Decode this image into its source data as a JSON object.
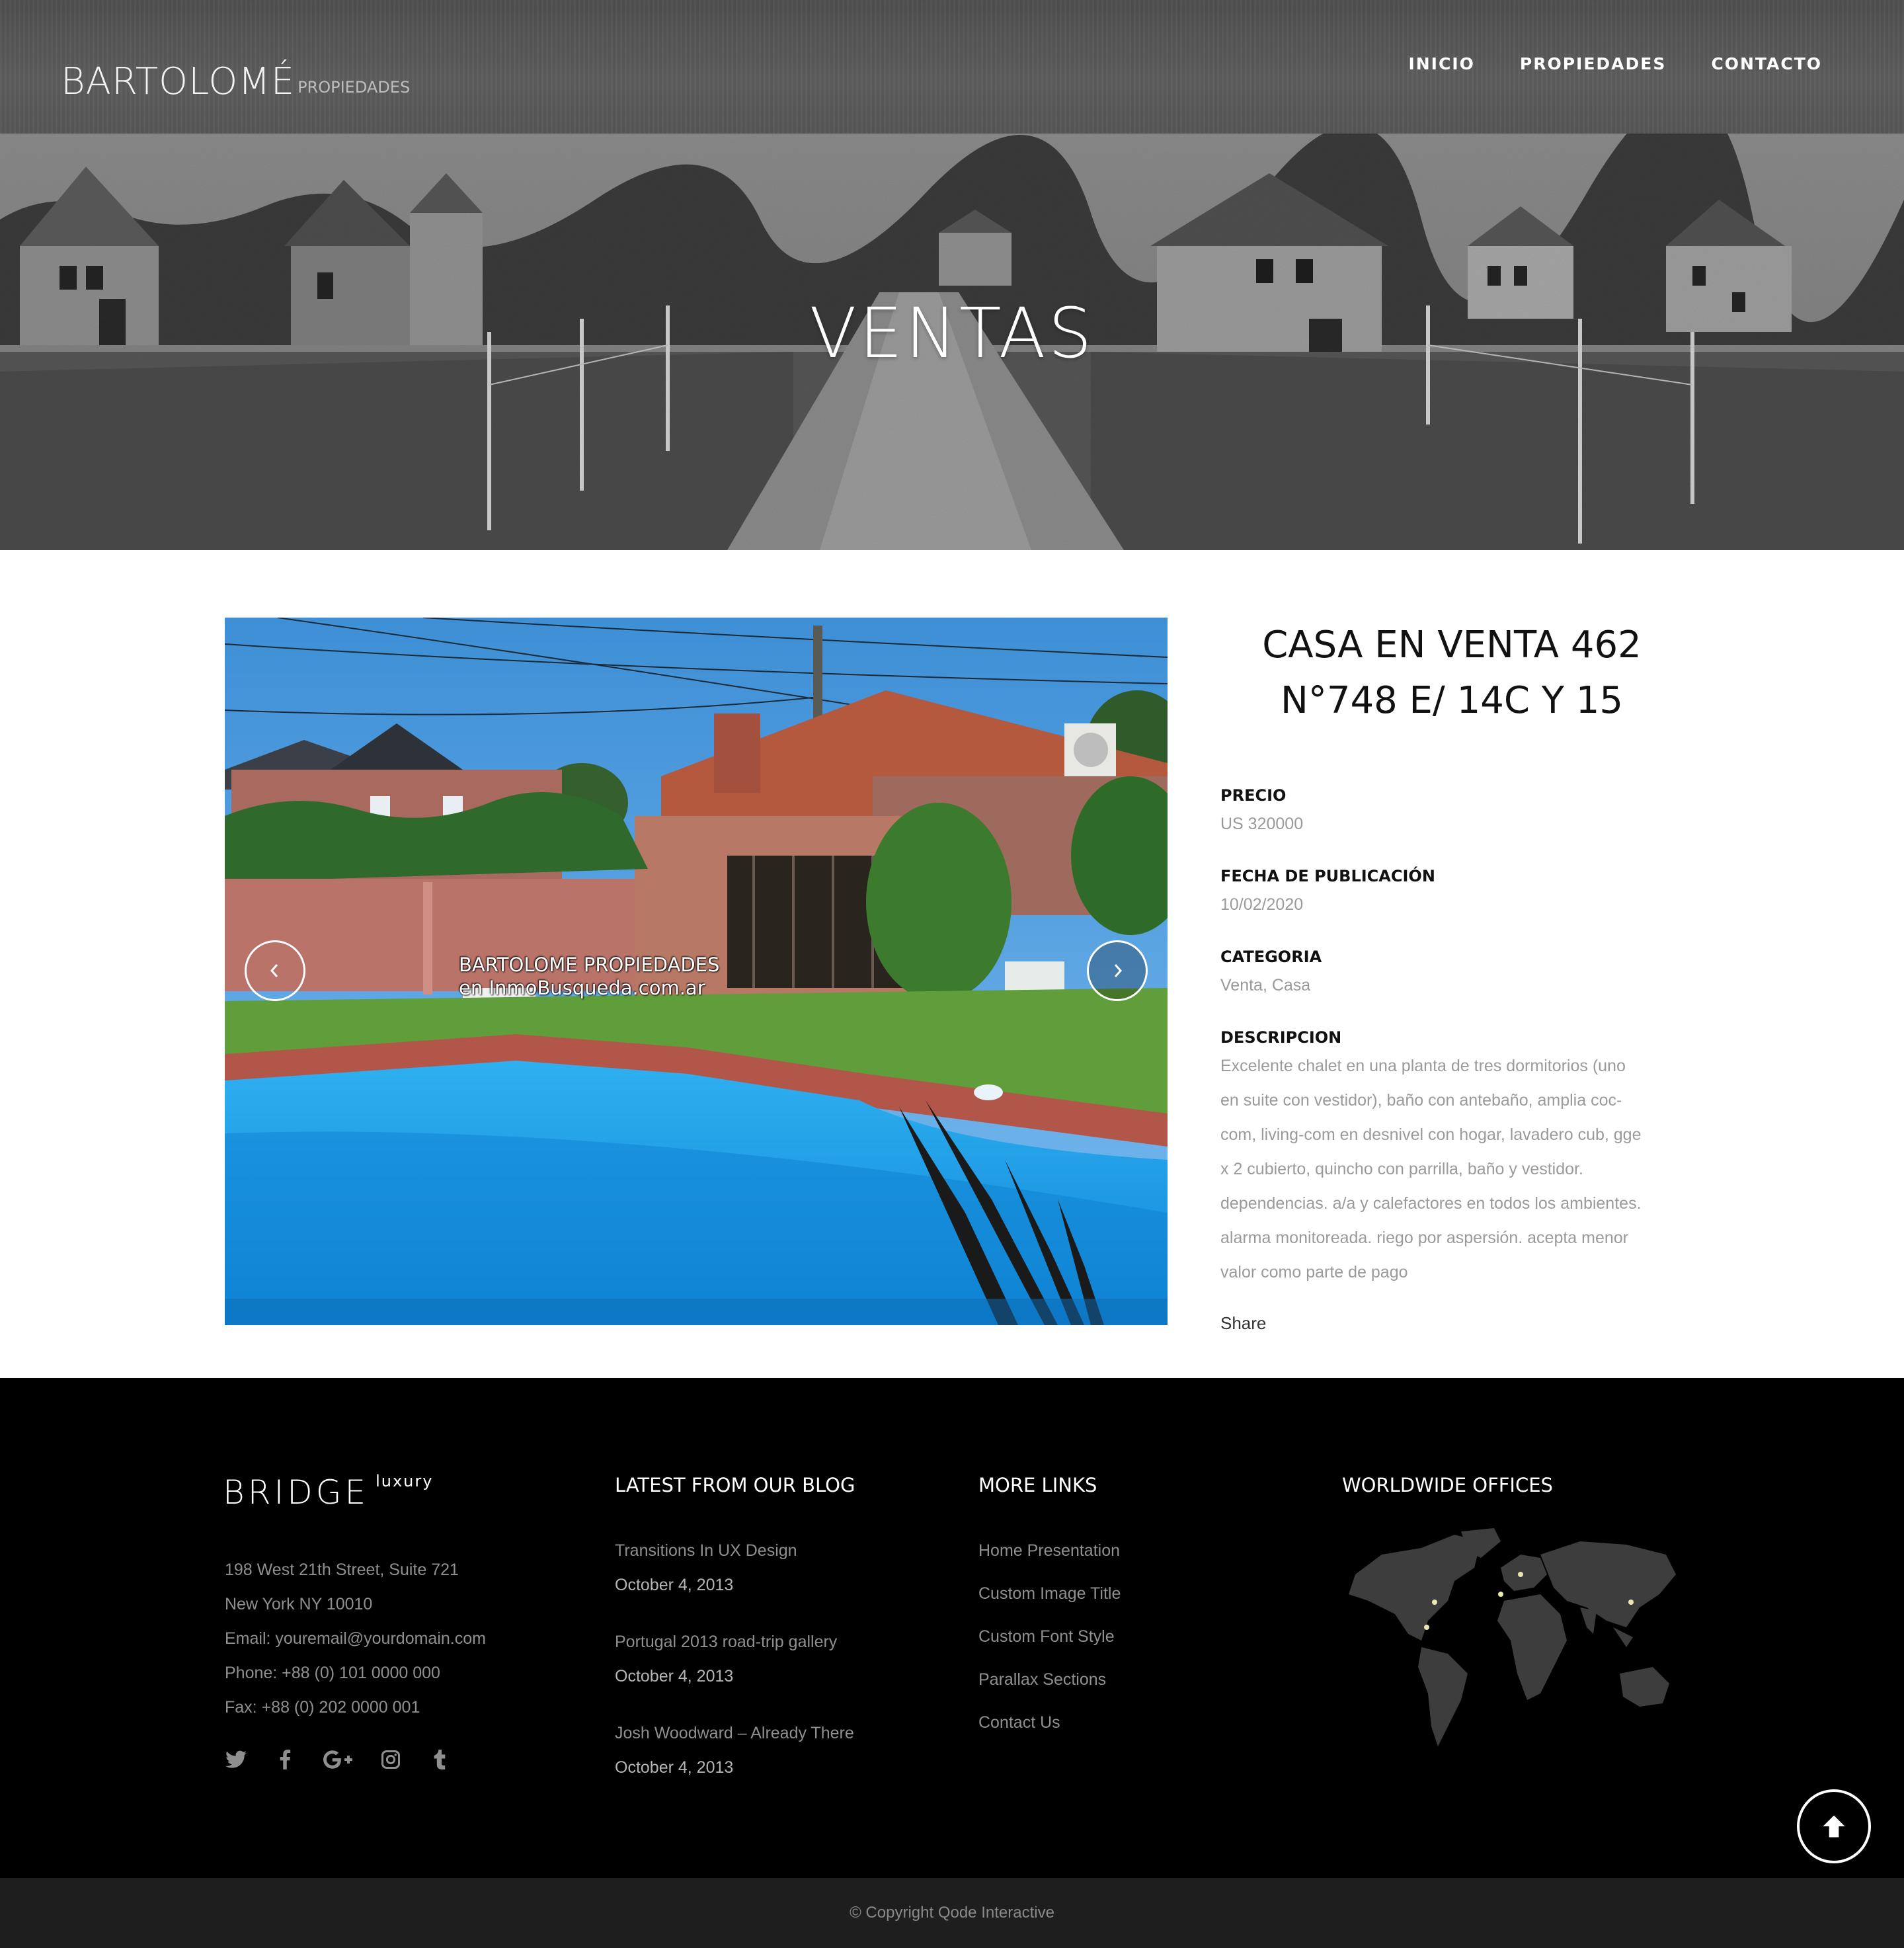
{
  "header": {
    "logo_main": "BARTOLOMÉ",
    "logo_sub": "PROPIEDADES",
    "nav": [
      {
        "label": "INICIO"
      },
      {
        "label": "PROPIEDADES"
      },
      {
        "label": "CONTACTO"
      }
    ]
  },
  "hero": {
    "title": "VENTAS"
  },
  "gallery": {
    "watermark_line1": "BARTOLOME PROPIEDADES",
    "watermark_line2": "en InmoBusqueda.com.ar",
    "prev_icon": "chevron-left-icon",
    "next_icon": "chevron-right-icon"
  },
  "property": {
    "title_line1": "CASA EN VENTA 462",
    "title_line2": "N°748 E/ 14C Y 15",
    "price_label": "PRECIO",
    "price_value": "US 320000",
    "date_label": "FECHA DE PUBLICACIÓN",
    "date_value": "10/02/2020",
    "category_label": "CATEGORIA",
    "category_value": "Venta, Casa",
    "description_label": "DESCRIPCION",
    "description_lines": [
      "Excelente chalet en una planta de tres dormitorios (uno",
      "en suite con vestidor), baño con antebaño, amplia coc-",
      "com, living-com en desnivel con hogar, lavadero cub, gge",
      "x 2 cubierto, quincho con parrilla, baño y vestidor.",
      "dependencias. a/a y calefactores en todos los ambientes.",
      "alarma monitoreada. riego por aspersión. acepta menor",
      "valor como parte de pago"
    ],
    "share_label": "Share"
  },
  "footer": {
    "logo_main": "BRIDGE",
    "logo_sub": "luxury",
    "contact": [
      "198 West 21th Street, Suite 721",
      "New York NY 10010",
      "Email: youremail@yourdomain.com",
      "Phone: +88 (0) 101 0000 000",
      "Fax: +88 (0) 202 0000 001"
    ],
    "socials": [
      "twitter-icon",
      "facebook-icon",
      "google-plus-icon",
      "instagram-icon",
      "tumblr-icon"
    ],
    "blog_heading": "LATEST FROM OUR BLOG",
    "blog": [
      {
        "title": "Transitions In UX Design",
        "date": "October 4, 2013"
      },
      {
        "title": "Portugal 2013 road-trip gallery",
        "date": "October 4, 2013"
      },
      {
        "title": "Josh Woodward – Already There",
        "date": "October 4, 2013"
      }
    ],
    "links_heading": "MORE LINKS",
    "links": [
      {
        "label": "Home Presentation"
      },
      {
        "label": "Custom Image Title"
      },
      {
        "label": "Custom Font Style"
      },
      {
        "label": "Parallax Sections"
      },
      {
        "label": "Contact Us"
      }
    ],
    "offices_heading": "WORLDWIDE OFFICES",
    "copyright": "© Copyright Qode Interactive"
  },
  "colors": {
    "accent_map": "#e8e8b0",
    "footer_bg": "#000000",
    "bottom_bar": "#1e1e1e"
  }
}
